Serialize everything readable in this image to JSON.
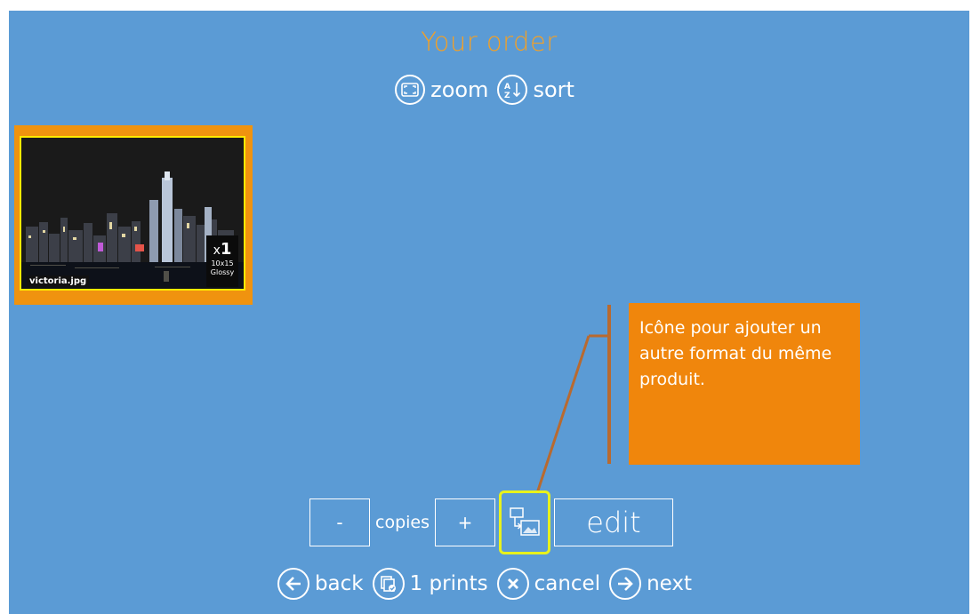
{
  "header": {
    "title": "Your order",
    "zoom_label": "zoom",
    "sort_label": "sort",
    "zoom_icon": "zoom-frame-icon",
    "sort_icon": "sort-az-icon"
  },
  "order_items": [
    {
      "filename": "victoria.jpg",
      "quantity_prefix": "x",
      "quantity": "1",
      "size": "10x15",
      "finish": "Glossy"
    }
  ],
  "callout": {
    "text": "Icône pour ajouter un autre format du même produit."
  },
  "controls": {
    "minus_label": "-",
    "copies_label": "copies",
    "plus_label": "+",
    "add_format_icon": "add-format-icon",
    "edit_label": "edit"
  },
  "footer": {
    "back_label": "back",
    "prints_label": "1 prints",
    "cancel_label": "cancel",
    "next_label": "next"
  },
  "colors": {
    "background": "#5b9bd5",
    "title": "#f4a025",
    "thumb_frame": "#f0930f",
    "selection": "#ffea00",
    "callout": "#f0860c",
    "highlight": "#e8f21c"
  }
}
